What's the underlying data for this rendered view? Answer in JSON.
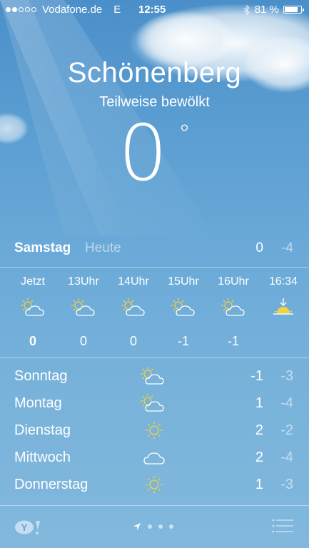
{
  "status_bar": {
    "carrier": "Vodafone.de",
    "network": "E",
    "time": "12:55",
    "battery": "81 %",
    "battery_level": 0.81,
    "signal_bars_filled": 2,
    "signal_bars_total": 5
  },
  "location": {
    "city": "Schönenberg",
    "condition": "Teilweise bewölkt",
    "temperature": "0",
    "degree_symbol": "°"
  },
  "today": {
    "day": "Samstag",
    "relative": "Heute",
    "high": "0",
    "low": "-4"
  },
  "hourly": [
    {
      "label": "Jetzt",
      "icon": "partly-sunny-icon",
      "temp": "0"
    },
    {
      "label": "13Uhr",
      "icon": "partly-sunny-icon",
      "temp": "0"
    },
    {
      "label": "14Uhr",
      "icon": "partly-sunny-icon",
      "temp": "0"
    },
    {
      "label": "15Uhr",
      "icon": "partly-sunny-icon",
      "temp": "-1"
    },
    {
      "label": "16Uhr",
      "icon": "partly-sunny-icon",
      "temp": "-1"
    },
    {
      "label": "16:34",
      "icon": "sunset-icon",
      "temp": ""
    }
  ],
  "forecast": [
    {
      "day": "Sonntag",
      "icon": "partly-sunny-icon",
      "high": "-1",
      "low": "-3"
    },
    {
      "day": "Montag",
      "icon": "partly-sunny-icon",
      "high": "1",
      "low": "-4"
    },
    {
      "day": "Dienstag",
      "icon": "sun-icon",
      "high": "2",
      "low": "-2"
    },
    {
      "day": "Mittwoch",
      "icon": "cloud-icon",
      "high": "2",
      "low": "-4"
    },
    {
      "day": "Donnerstag",
      "icon": "sun-icon",
      "high": "1",
      "low": "-3"
    }
  ],
  "footer": {
    "logo": "yahoo-logo",
    "pages": 4,
    "current_page": "location-arrow-icon",
    "menu_icon": "list-icon"
  },
  "colors": {
    "sky_top": "#4a8fc9",
    "sky_bottom": "#82b8dc",
    "sun_yellow": "#f3d33a"
  }
}
